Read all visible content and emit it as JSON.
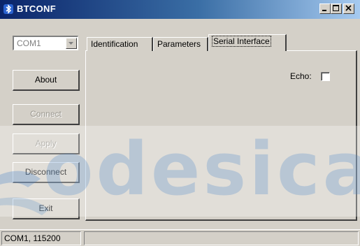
{
  "window": {
    "title": "BTCONF",
    "controls": [
      "minimize",
      "maximize",
      "close"
    ]
  },
  "port_select": {
    "value": "COM1"
  },
  "buttons": [
    {
      "label": "About",
      "enabled": true
    },
    {
      "label": "Connect",
      "enabled": false
    },
    {
      "label": "Apply",
      "enabled": false
    },
    {
      "label": "Disconnect",
      "enabled": true
    },
    {
      "label": "Exit",
      "enabled": true
    }
  ],
  "tabs": [
    {
      "label": "Identification",
      "active": false
    },
    {
      "label": "Parameters",
      "active": false
    },
    {
      "label": "Serial Interface",
      "active": true
    }
  ],
  "serial_interface": {
    "echo_label": "Echo:",
    "echo_checked": false
  },
  "status_bar": {
    "connection": "COM1, 115200",
    "message": ""
  },
  "watermark": {
    "text": "odesica"
  },
  "colors": {
    "face": "#d4d0c8",
    "title_start": "#0a246a",
    "title_end": "#a6caf0",
    "disabled_text": "#9a978f"
  }
}
